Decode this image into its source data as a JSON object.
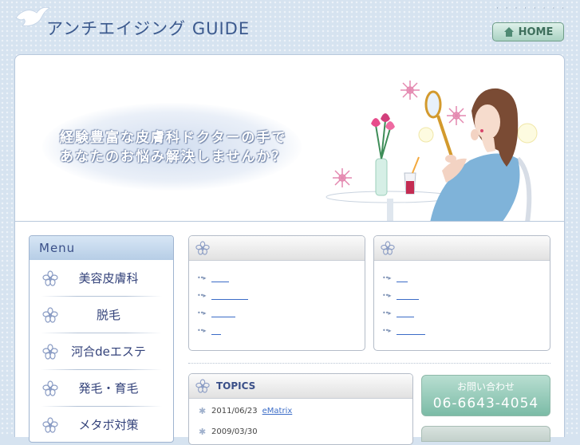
{
  "header": {
    "site_title": "アンチエイジング GUIDE",
    "top_dots": "· · ·   · · · · ·",
    "home_label": "HOME"
  },
  "hero": {
    "line1": "経験豊富な皮膚科ドクターの手で",
    "line2": "あなたのお悩み解決しませんか？"
  },
  "menu": {
    "title": "Menu",
    "items": [
      {
        "label": "美容皮膚科"
      },
      {
        "label": "脱毛"
      },
      {
        "label": "河合deエステ"
      },
      {
        "label": "発毛・育毛"
      },
      {
        "label": "メタボ対策"
      }
    ]
  },
  "panels": [
    {
      "link_widths": [
        22,
        46,
        30,
        12
      ]
    },
    {
      "link_widths": [
        14,
        28,
        22,
        36
      ]
    }
  ],
  "topics": {
    "title": "TOPICS",
    "items": [
      {
        "date": "2011/06/23",
        "link": "eMatrix"
      },
      {
        "date": "2009/03/30",
        "link": ""
      }
    ]
  },
  "contact": {
    "label": "お問い合わせ",
    "phone": "06-6643-4054"
  },
  "colors": {
    "background": "#d6e3f0",
    "menu_text": "#33427a",
    "link": "#3b6cc7",
    "contact_green": "#7bbba6"
  }
}
